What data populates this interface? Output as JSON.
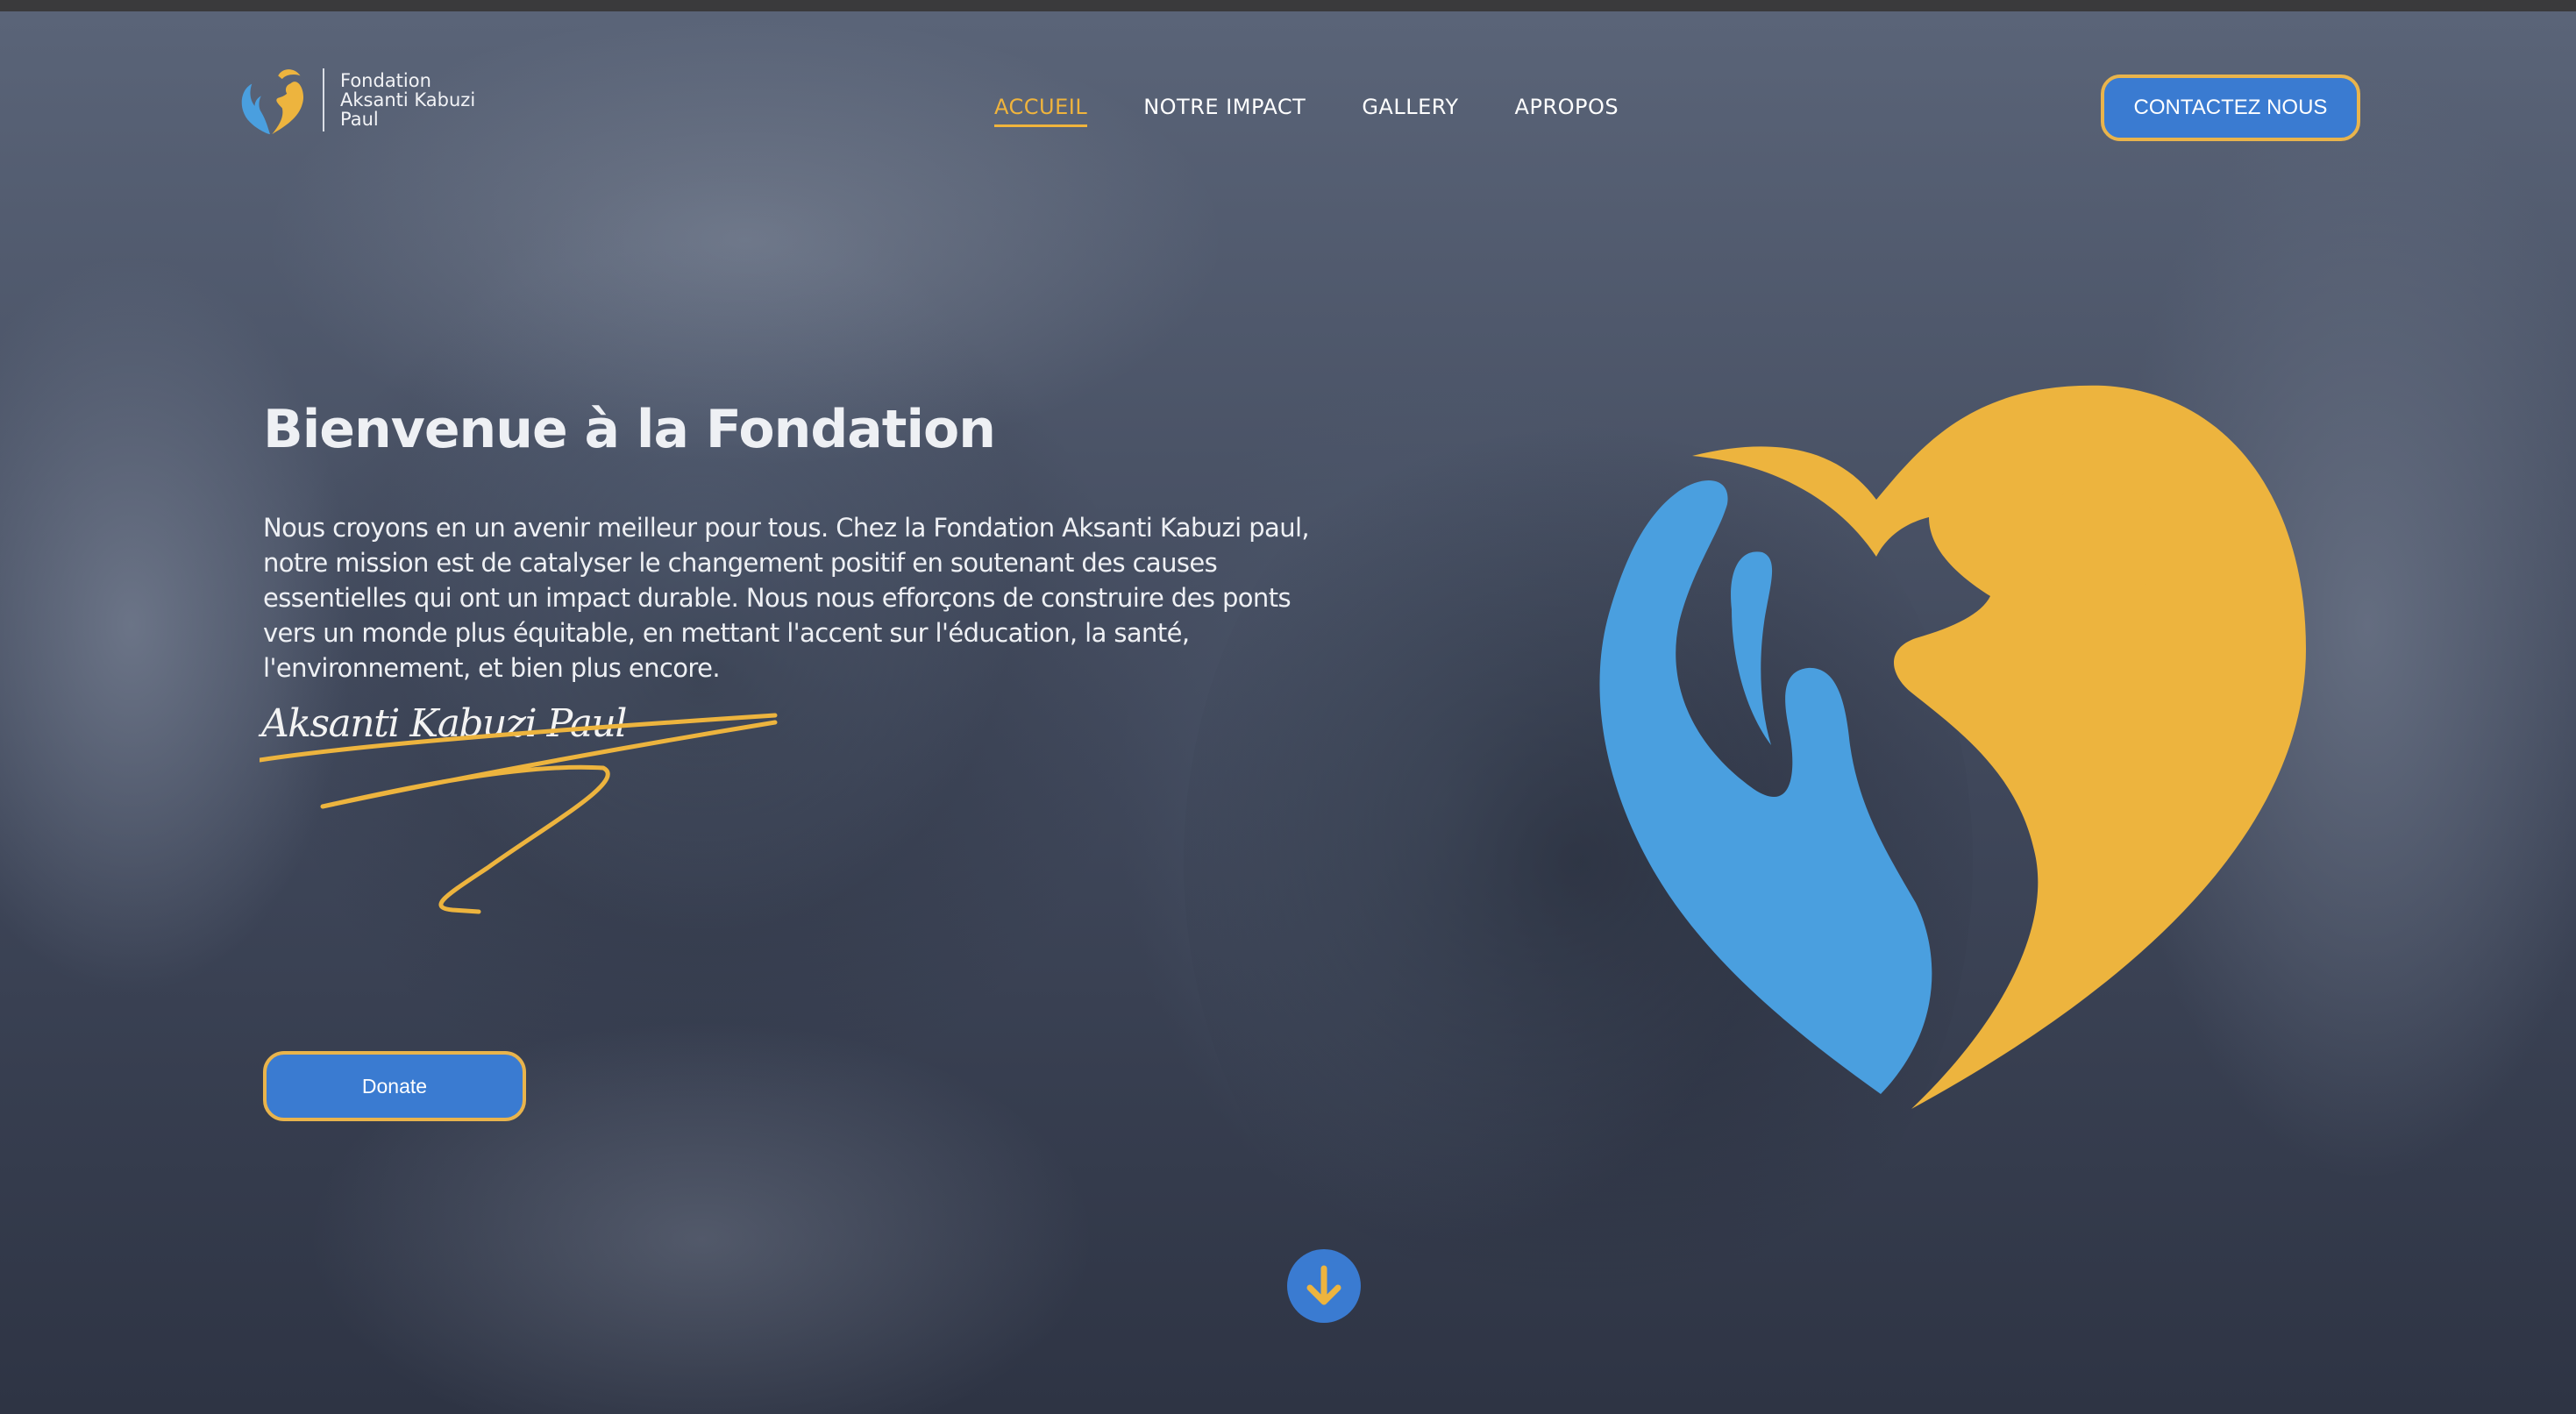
{
  "brand": {
    "name_lines": [
      "Fondation",
      "Aksanti Kabuzi",
      "Paul"
    ],
    "logo_icon": "heart-hands-person-icon",
    "colors": {
      "blue": "#4a9fdf",
      "gold": "#edb43e",
      "button_blue": "#3a7bd1",
      "button_border": "#e9b44c"
    }
  },
  "nav": {
    "items": [
      {
        "label": "ACCUEIL",
        "active": true
      },
      {
        "label": "NOTRE IMPACT",
        "active": false
      },
      {
        "label": "GALLERY",
        "active": false
      },
      {
        "label": "APROPOS",
        "active": false
      }
    ],
    "contact_label": "CONTACTEZ NOUS"
  },
  "hero": {
    "title": "Bienvenue à la Fondation",
    "lead": "Nous croyons en un avenir meilleur pour tous. Chez la Fondation Aksanti Kabuzi paul, notre mission est de catalyser le changement positif en soutenant des causes essentielles qui ont un impact durable. Nous nous efforçons de construire des ponts vers un monde plus équitable, en mettant l'accent sur l'éducation, la santé, l'environnement, et bien plus encore.",
    "signature": "Aksanti Kabuzi Paul",
    "donate_label": "Donate",
    "scroll_icon": "arrow-down-icon"
  }
}
